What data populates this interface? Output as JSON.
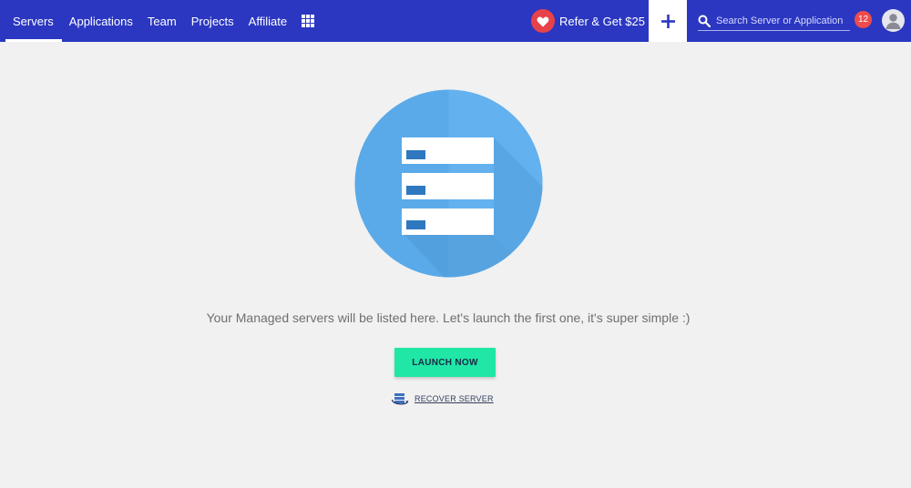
{
  "nav": {
    "items": [
      {
        "label": "Servers",
        "active": true
      },
      {
        "label": "Applications"
      },
      {
        "label": "Team"
      },
      {
        "label": "Projects"
      },
      {
        "label": "Affiliate"
      }
    ],
    "apps_icon": "grid-icon"
  },
  "refer": {
    "label": "Refer & Get $25",
    "icon": "heart-icon"
  },
  "add": {
    "icon": "plus-icon"
  },
  "search": {
    "placeholder": "Search Server or Application",
    "icon": "search-icon"
  },
  "notifications": {
    "count": "12"
  },
  "user": {
    "icon": "user-avatar-icon"
  },
  "main": {
    "illustration": "servers-stack-icon",
    "message": "Your Managed servers will be listed here. Let's launch the first one, it's super simple :)",
    "launch_label": "LAUNCH NOW",
    "recover_label": "RECOVER SERVER",
    "recover_icon": "recover-server-icon"
  },
  "colors": {
    "topbar": "#2b37c1",
    "launch": "#20e6a6",
    "badge": "#ef4b4b",
    "heart": "#e84249",
    "circle": "#5aaae9"
  }
}
